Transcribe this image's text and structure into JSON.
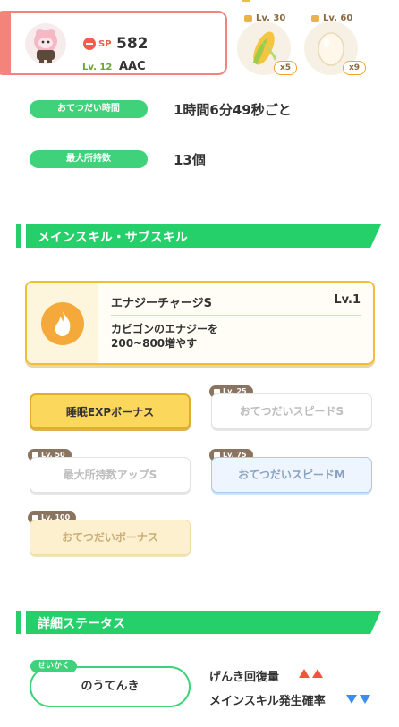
{
  "pokemon": {
    "sp_label": "SP",
    "sp_value": "582",
    "level_label": "Lv. 12",
    "name": "AAC"
  },
  "items": [
    {
      "level": "Lv. 30",
      "count": "x5",
      "icon": "corn-icon"
    },
    {
      "level": "Lv. 60",
      "count": "x9",
      "icon": "egg-icon"
    }
  ],
  "info": [
    {
      "label": "おてつだい時間",
      "value": "1時間6分49秒ごと"
    },
    {
      "label": "最大所持数",
      "value": "13個"
    }
  ],
  "skills_section": {
    "title": "メインスキル・サブスキル"
  },
  "main_skill": {
    "name": "エナジーチャージS",
    "level": "Lv.1",
    "desc_line1": "カビゴンのエナジーを",
    "desc_line2": "200~800増やす",
    "icon": "flame-icon"
  },
  "sub_skills": [
    {
      "label": "睡眠EXPボーナス",
      "unlock": ""
    },
    {
      "label": "おてつだいスピードS",
      "unlock": "Lv. 25"
    },
    {
      "label": "最大所持数アップS",
      "unlock": "Lv. 50"
    },
    {
      "label": "おてつだいスピードM",
      "unlock": "Lv. 75"
    },
    {
      "label": "おてつだいボーナス",
      "unlock": "Lv. 100"
    }
  ],
  "details_section": {
    "title": "詳細ステータス"
  },
  "nature": {
    "tag": "せいかく",
    "name": "のうてんき",
    "up_stat": "げんき回復量",
    "down_stat": "メインスキル発生確率"
  },
  "colors": {
    "accent_green": "#25cf6a",
    "gold": "#f2bd3a",
    "coral": "#f4837a"
  }
}
